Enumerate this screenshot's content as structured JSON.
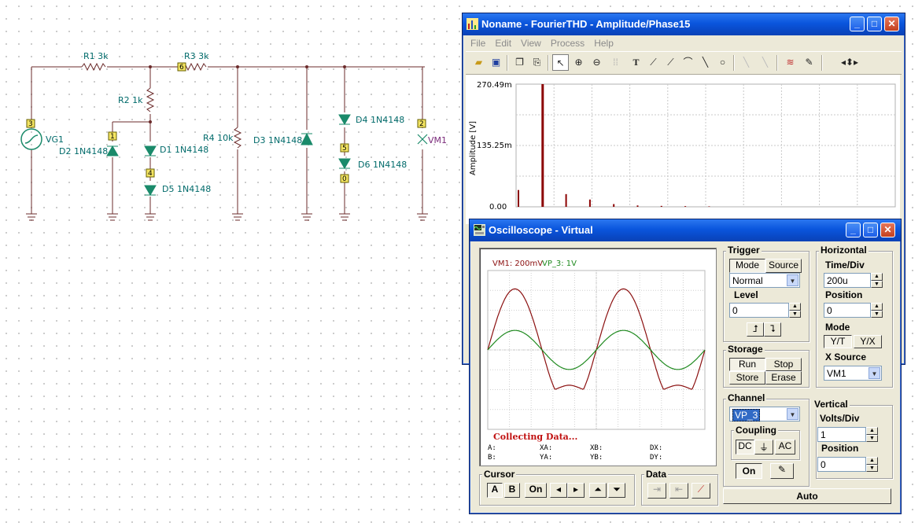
{
  "schematic": {
    "components": {
      "r1": "R1 3k",
      "r3": "R3 3k",
      "r2": "R2 1k",
      "r4": "R4 10k",
      "d1": "D1 1N4148",
      "d2": "D2 1N4148",
      "d3": "D3 1N4148",
      "d4": "D4 1N4148",
      "d5": "D5 1N4148",
      "d6": "D6 1N4148",
      "vg1": "VG1",
      "vm1": "VM1"
    },
    "nodes": {
      "n3": "3",
      "n6": "6",
      "n1": "1",
      "n4": "4",
      "n5": "5",
      "n0": "0",
      "n2": "2"
    },
    "colors": {
      "wire": "#6b2b2b",
      "label": "#006a6a",
      "diode": "#1a8a6a"
    }
  },
  "fourier": {
    "title": "Noname - FourierTHD - Amplitude/Phase15",
    "menu": [
      "File",
      "Edit",
      "View",
      "Process",
      "Help"
    ],
    "toolbar_icons": [
      "open-icon",
      "save-icon",
      "copy-icon",
      "paste-icon",
      "pointer-icon",
      "zoom-in-icon",
      "zoom-100-icon",
      "grid-icon",
      "text-icon",
      "cursor-a-icon",
      "cursor-b-icon",
      "curve-icon",
      "line-icon",
      "circle-icon",
      "disabled-a-icon",
      "disabled-b-icon",
      "color-icon",
      "pen-icon",
      "scroll-icon"
    ],
    "chart_data": {
      "type": "bar",
      "ylabel": "Amplitude [V]",
      "yticks": [
        "270.49m",
        "135.25m",
        "0.00"
      ],
      "ylim": [
        0,
        270.49
      ],
      "values": [
        37,
        270.49,
        28,
        16,
        6,
        3,
        2,
        1.5,
        1
      ],
      "harmonic_index": [
        0,
        1,
        2,
        3,
        4,
        5,
        6,
        7,
        8
      ],
      "bar_color": "#8b0000",
      "grid": true
    }
  },
  "scope": {
    "title": "Oscilloscope - Virtual",
    "legend": {
      "vm1": "VM1: 200mV",
      "vp3": "VP_3: 1V"
    },
    "status": "Collecting Data...",
    "readouts": {
      "a": "A:",
      "b": "B:",
      "xa": "XA:",
      "ya": "YA:",
      "xb": "XB:",
      "yb": "YB:",
      "dx": "DX:",
      "dy": "DY:"
    },
    "chart_data": {
      "type": "line",
      "series": [
        {
          "name": "VM1",
          "color": "#8b1010",
          "amplitude": 1.5,
          "cycles": 2
        },
        {
          "name": "VP_3",
          "color": "#1f8a1f",
          "amplitude": 0.48,
          "cycles": 2
        }
      ],
      "grid": {
        "x_divisions": 10,
        "y_divisions": 8
      },
      "grid_on": true
    },
    "trigger": {
      "label": "Trigger",
      "mode": "Mode",
      "source": "Source",
      "mode_value": "Normal",
      "level_label": "Level",
      "level_value": "0"
    },
    "horizontal": {
      "label": "Horizontal",
      "timediv_label": "Time/Div",
      "timediv_value": "200u",
      "position_label": "Position",
      "position_value": "0",
      "mode_label": "Mode",
      "yt": "Y/T",
      "yx": "Y/X",
      "xsource_label": "X Source",
      "xsource_value": "VM1"
    },
    "storage": {
      "label": "Storage",
      "run": "Run",
      "stop": "Stop",
      "store": "Store",
      "erase": "Erase"
    },
    "channel": {
      "label": "Channel",
      "value": "VP_3",
      "coupling_label": "Coupling",
      "dc": "DC",
      "ac": "AC",
      "on": "On"
    },
    "vertical": {
      "label": "Vertical",
      "voltsdiv_label": "Volts/Div",
      "voltsdiv_value": "1",
      "position_label": "Position",
      "position_value": "0"
    },
    "cursor": {
      "label": "Cursor",
      "a": "A",
      "b": "B",
      "on": "On"
    },
    "data": {
      "label": "Data"
    },
    "auto": "Auto"
  }
}
